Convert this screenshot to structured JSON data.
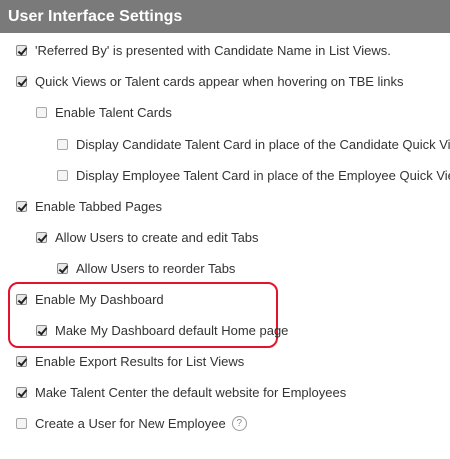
{
  "section": {
    "title": "User Interface Settings"
  },
  "settings": [
    {
      "label": "'Referred By' is presented with Candidate Name in List Views.",
      "checked": true
    },
    {
      "label": "Quick Views or Talent cards appear when hovering on TBE links",
      "checked": true
    },
    {
      "label": "Enable Talent Cards",
      "checked": false
    },
    {
      "label": "Display Candidate Talent Card in place of the Candidate Quick View.",
      "checked": false
    },
    {
      "label": "Display Employee Talent Card in place of the Employee Quick View.",
      "checked": false
    },
    {
      "label": "Enable Tabbed Pages",
      "checked": true
    },
    {
      "label": "Allow Users to create and edit Tabs",
      "checked": true
    },
    {
      "label": "Allow Users to reorder Tabs",
      "checked": true
    },
    {
      "label": "Enable My Dashboard",
      "checked": true
    },
    {
      "label": "Make My Dashboard default Home page",
      "checked": true
    },
    {
      "label": "Enable Export Results for List Views",
      "checked": true
    },
    {
      "label": "Make Talent Center the default website for Employees",
      "checked": true
    },
    {
      "label": "Create a User for New Employee",
      "checked": false
    }
  ],
  "help": {
    "symbol": "?"
  },
  "colors": {
    "header_bg": "#7a7a7a",
    "highlight": "#e3132b"
  }
}
